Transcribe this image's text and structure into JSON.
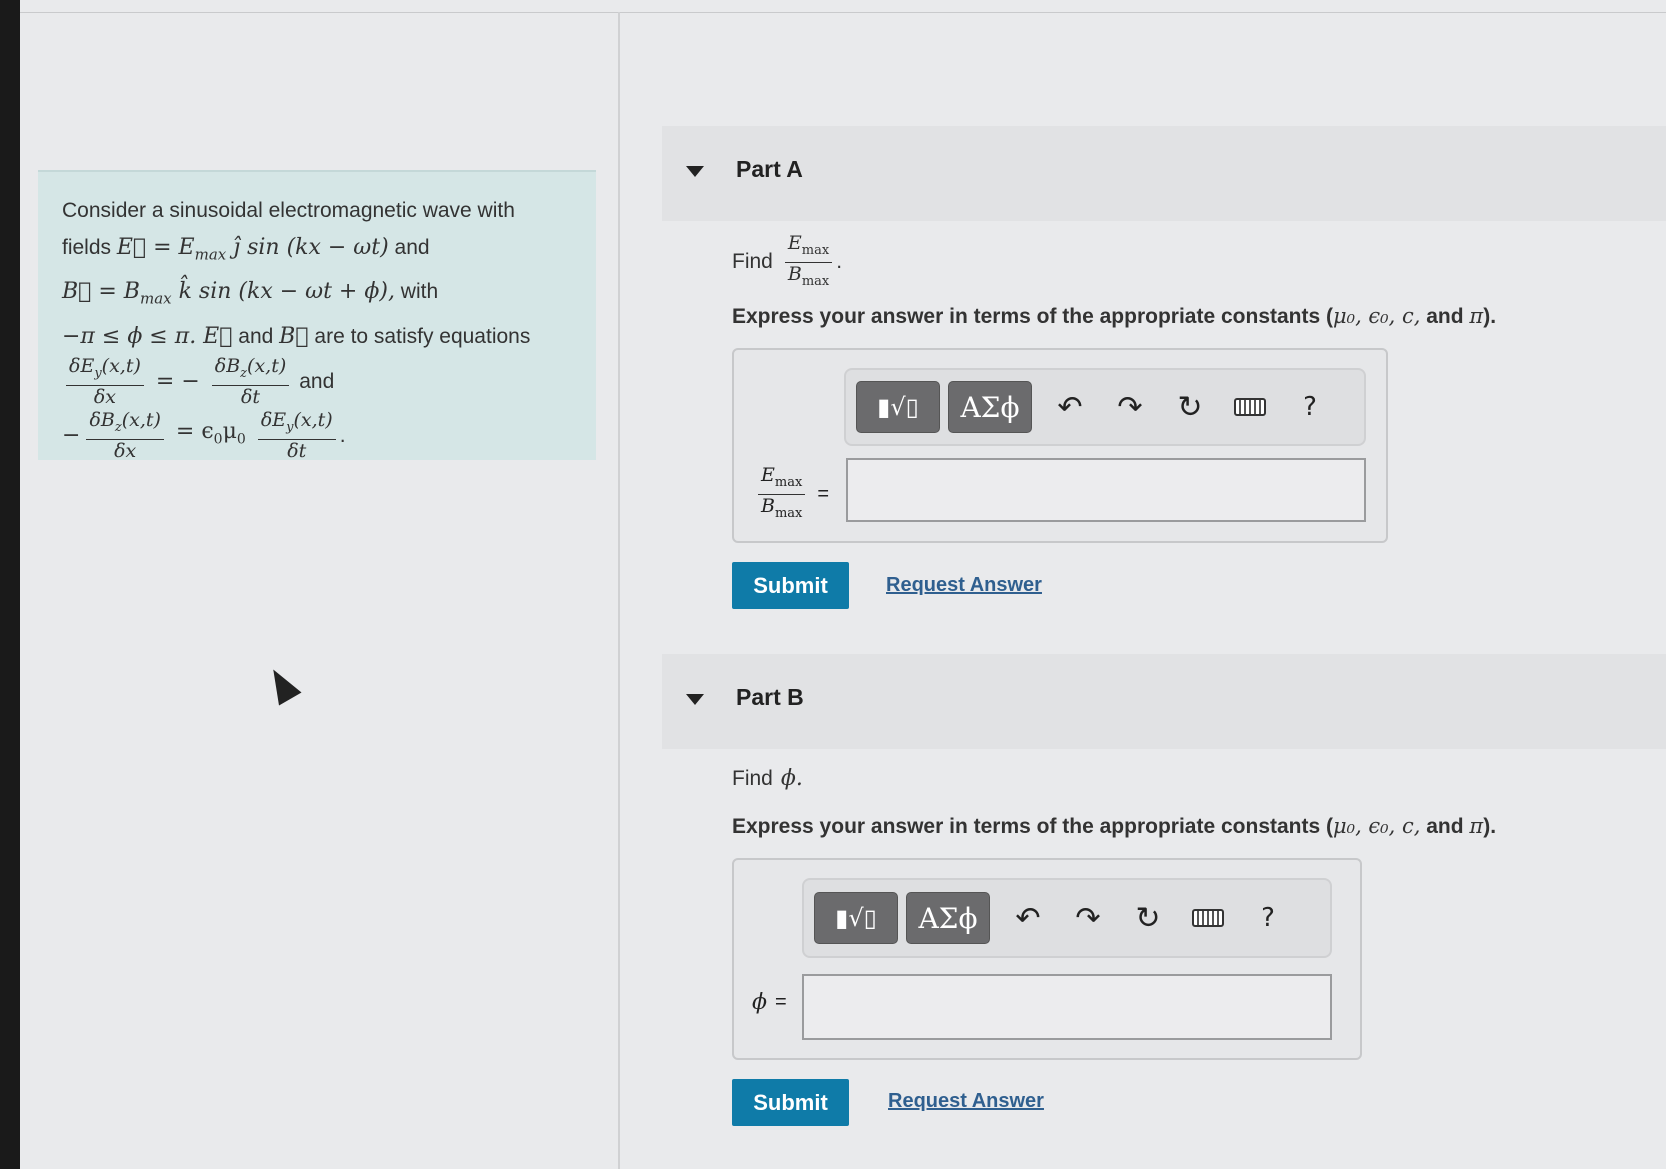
{
  "intro": {
    "l1": "Consider a sinusoidal electromagnetic wave with",
    "l2_pre": "fields",
    "l2_math": "E⃗ = E",
    "l2_sub": "max",
    "l2_math2": "ĵ sin (kx − ωt)",
    "l2_post": "and",
    "l3_math": "B⃗ = B",
    "l3_sub": "max",
    "l3_math2": "k̂ sin (kx − ωt + ϕ),",
    "l3_post": "with",
    "l4_math": "−π ≤ ϕ ≤ π. E⃗",
    "l4_and": "and",
    "l4_math2": "B⃗",
    "l4_post": "are to satisfy equations",
    "eq1_num1": "δE",
    "eq1_num1_sub": "y",
    "eq1_num1_arg": "(x,t)",
    "eq1_den1": "δx",
    "eq1_rel": "= −",
    "eq1_num2": "δB",
    "eq1_num2_sub": "z",
    "eq1_num2_arg": "(x,t)",
    "eq1_den2": "δt",
    "eq1_post": "and",
    "eq2_pre": "−",
    "eq2_num1": "δB",
    "eq2_num1_sub": "z",
    "eq2_num1_arg": "(x,t)",
    "eq2_den1": "δx",
    "eq2_rel": "= ϵ",
    "eq2_rel_sub0": "0",
    "eq2_mu": "μ",
    "eq2_mu_sub": "0",
    "eq2_num2": "δE",
    "eq2_num2_sub": "y",
    "eq2_num2_arg": "(x,t)",
    "eq2_den2": "δt",
    "eq2_post": "."
  },
  "partA": {
    "title": "Part A",
    "find_label": "Find",
    "find_num": "E",
    "find_num_sub": "max",
    "find_den": "B",
    "find_den_sub": "max",
    "find_post": ".",
    "express": "Express your answer in terms of the appropriate constants (",
    "consts": "μ₀, ϵ₀, c,",
    "and": "and",
    "pi": "π",
    "close": ").",
    "lhs_num": "E",
    "lhs_num_sub": "max",
    "lhs_den": "B",
    "lhs_den_sub": "max",
    "lhs_eq": "=",
    "submit": "Submit",
    "request": "Request Answer"
  },
  "partB": {
    "title": "Part B",
    "find_label": "Find",
    "find_var": "ϕ.",
    "express": "Express your answer in terms of the appropriate constants (",
    "consts": "μ₀, ϵ₀, c,",
    "and": "and",
    "pi": "π",
    "close": ").",
    "lhs": "ϕ",
    "lhs_eq": "=",
    "submit": "Submit",
    "request": "Request Answer"
  },
  "toolbar": {
    "template_glyph": "▮√▯",
    "greek_glyph": "ΑΣϕ",
    "undo_glyph": "↶",
    "redo_glyph": "↷",
    "reset_glyph": "↻",
    "help_glyph": "?",
    "icons": [
      "template-icon",
      "greek-icon",
      "undo-icon",
      "redo-icon",
      "reset-icon",
      "keyboard-icon",
      "help-icon"
    ]
  },
  "colors": {
    "submit": "#0f7ba8",
    "link": "#2f5f8f",
    "intro_bg": "#d5e6e6"
  }
}
